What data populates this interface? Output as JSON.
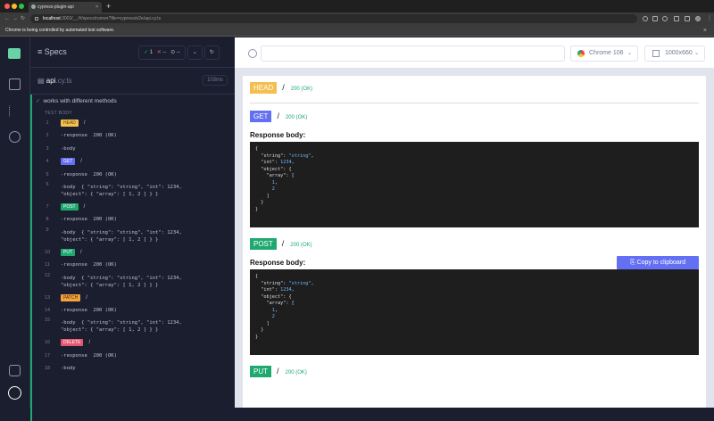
{
  "browser": {
    "tab_title": "cypress-plugin-api",
    "tab_close": "×",
    "new_tab": "+",
    "url_host": "localhost",
    "url_path": ":3003/__/#/specs/runner?file=cypress/e2e/api.cy.ts",
    "info_bar": "Chrome is being controlled by automated test software.",
    "info_close": "×"
  },
  "reporter": {
    "specs_label": "Specs",
    "passed": "1",
    "failed": "--",
    "pending": "--",
    "spec_name": "api",
    "spec_ext": ".cy.ts",
    "spec_time": "103ms",
    "test_title": "works with different methods",
    "test_body_label": "TEST BODY",
    "commands": [
      {
        "n": "1",
        "badge": "HEAD",
        "kind": "head",
        "rest": "/"
      },
      {
        "n": "2",
        "text": "-response  200 (OK)"
      },
      {
        "n": "3",
        "text": "-body"
      },
      {
        "n": "4",
        "badge": "GET",
        "kind": "get",
        "rest": "/"
      },
      {
        "n": "5",
        "text": "-response  200 (OK)"
      },
      {
        "n": "6",
        "text": "-body  { \"string\": \"string\", \"int\": 1234,\n\"object\": { \"array\": [ 1, 2 ] } }",
        "tall": true
      },
      {
        "n": "7",
        "badge": "POST",
        "kind": "post",
        "rest": "/"
      },
      {
        "n": "8",
        "text": "-response  200 (OK)"
      },
      {
        "n": "9",
        "text": "-body  { \"string\": \"string\", \"int\": 1234,\n\"object\": { \"array\": [ 1, 2 ] } }",
        "tall": true
      },
      {
        "n": "10",
        "badge": "PUT",
        "kind": "put",
        "rest": "/"
      },
      {
        "n": "11",
        "text": "-response  200 (OK)"
      },
      {
        "n": "12",
        "text": "-body  { \"string\": \"string\", \"int\": 1234,\n\"object\": { \"array\": [ 1, 2 ] } }",
        "tall": true
      },
      {
        "n": "13",
        "badge": "PATCH",
        "kind": "patch",
        "rest": "/"
      },
      {
        "n": "14",
        "text": "-response  200 (OK)"
      },
      {
        "n": "15",
        "text": "-body  { \"string\": \"string\", \"int\": 1234,\n\"object\": { \"array\": [ 1, 2 ] } }",
        "tall": true
      },
      {
        "n": "16",
        "badge": "DELETE",
        "kind": "delete",
        "rest": "/"
      },
      {
        "n": "17",
        "text": "-response  200 (OK)"
      },
      {
        "n": "18",
        "text": "-body"
      }
    ]
  },
  "app_header": {
    "browser_name": "Chrome 106",
    "viewport": "1000x660"
  },
  "aut": {
    "head": {
      "method": "HEAD",
      "path": "/",
      "status": "200 (OK)"
    },
    "get": {
      "method": "GET",
      "path": "/",
      "status": "200 (OK)"
    },
    "post": {
      "method": "POST",
      "path": "/",
      "status": "200 (OK)"
    },
    "put": {
      "method": "PUT",
      "path": "/",
      "status": "200 (OK)"
    },
    "response_body_label": "Response body:",
    "copy_label": "Copy to clipboard"
  },
  "colors": {
    "sidebar_bg": "#1b1e2e",
    "pass_green": "#1fa971",
    "get_indigo": "#6470f3",
    "head_yellow": "#f3bf4e",
    "patch_orange": "#f3a33e",
    "delete_red": "#e45770"
  }
}
